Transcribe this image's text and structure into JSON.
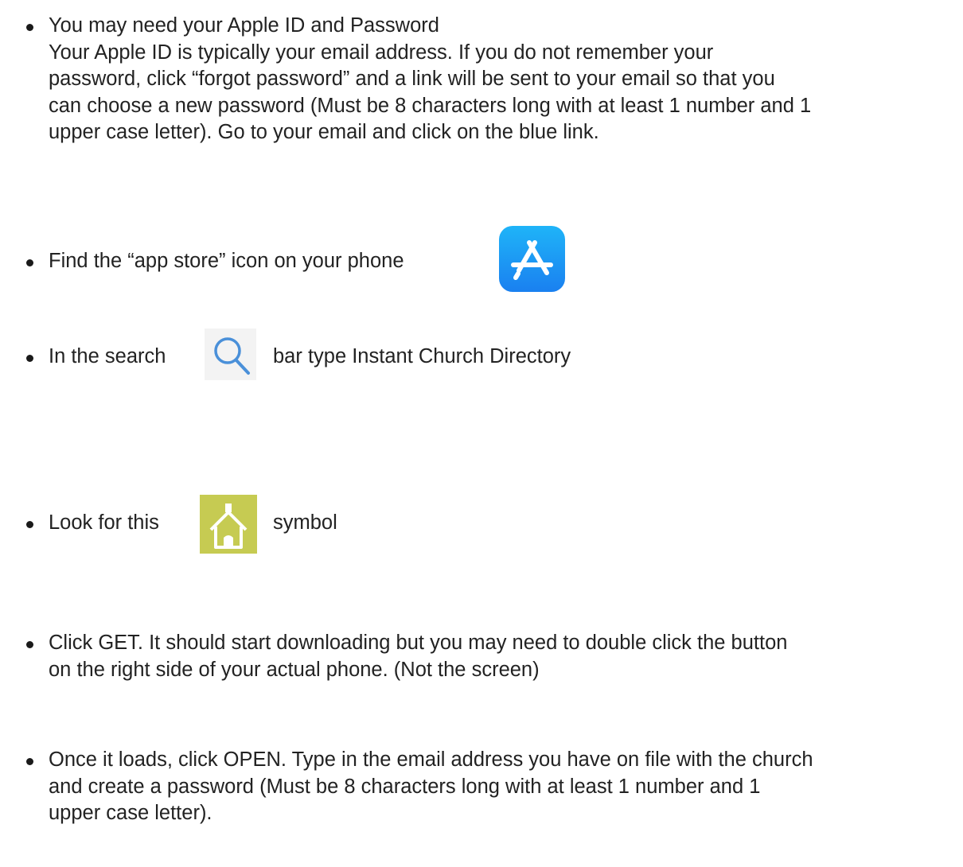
{
  "items": [
    {
      "lines": [
        "You may need your Apple ID and Password",
        "Your Apple ID is typically your email address. If you do not remember your",
        "password, click “forgot password” and a link will be sent to your email so that you",
        "can choose a new password (Must be 8 characters long with at least 1 number and 1",
        "upper case letter). Go to your email and click on the blue link."
      ]
    },
    {
      "text": "Find the “app store” icon on your phone",
      "icon": "app-store-icon"
    },
    {
      "text_before": "In the search",
      "text_after": "bar type Instant Church Directory",
      "icon": "search-icon"
    },
    {
      "text_before": "Look for this",
      "text_after": "symbol",
      "icon": "church-directory-icon"
    },
    {
      "lines": [
        "Click GET. It should start downloading but you may need to double click the button",
        "on the right side of your actual phone. (Not the screen)"
      ]
    },
    {
      "lines": [
        "Once it loads, click OPEN. Type in the email address you have on file with the church",
        "and create a password (Must be 8 characters long with at least 1 number and 1",
        "upper case letter)."
      ]
    }
  ],
  "colors": {
    "text": "#222222",
    "app_store_gradient_top": "#1fb4f8",
    "app_store_gradient_bottom": "#1a80f0",
    "search_icon_stroke": "#4a90d9",
    "church_icon_bg": "#c6cb52"
  }
}
